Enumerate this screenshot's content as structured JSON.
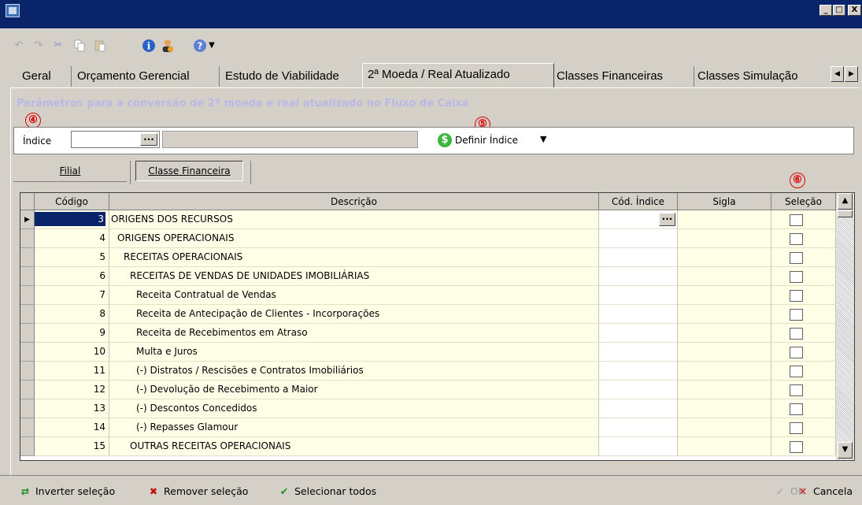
{
  "window": {
    "minimize": "_",
    "maximize": "□",
    "close": "X"
  },
  "toolbar": {
    "icons": [
      "undo-icon",
      "redo-icon",
      "cut-icon",
      "copy-icon",
      "paste-icon",
      "info-icon",
      "user-icon",
      "help-icon",
      "dropdown-arrow-icon"
    ]
  },
  "tabs": [
    {
      "label": "Geral",
      "active": false
    },
    {
      "label": "Orçamento Gerencial",
      "active": false
    },
    {
      "label": "Estudo de Viabilidade",
      "active": false
    },
    {
      "label": "2ª Moeda / Real Atualizado",
      "active": true
    },
    {
      "label": "Classes Financeiras",
      "active": false
    },
    {
      "label": "Classes Simulação",
      "active": false
    }
  ],
  "section": {
    "title": "Parâmetros para a conversão de 2ª moeda e real atualizado no Fluxo de Caixa"
  },
  "markers": {
    "m4": "④",
    "m5": "⑤",
    "m6": "⑥"
  },
  "index_field": {
    "label": "Índice",
    "value": "",
    "ellipsis": "...",
    "description": "",
    "define_label": "Definir Índice",
    "define_caret": "▼"
  },
  "subtabs": [
    {
      "label": "Filial",
      "active": false
    },
    {
      "label": "Classe Financeira",
      "active": true
    }
  ],
  "grid": {
    "columns": [
      "Código",
      "Descrição",
      "Cód. Índice",
      "Sigla",
      "Seleção"
    ],
    "rows": [
      {
        "code": "3",
        "desc": "ORIGENS DOS RECURSOS",
        "indent": 0,
        "selected": true,
        "checked": false
      },
      {
        "code": "4",
        "desc": "ORIGENS OPERACIONAIS",
        "indent": 1,
        "selected": false,
        "checked": false
      },
      {
        "code": "5",
        "desc": "RECEITAS OPERACIONAIS",
        "indent": 2,
        "selected": false,
        "checked": false
      },
      {
        "code": "6",
        "desc": "RECEITAS DE VENDAS DE UNIDADES IMOBILIÁRIAS",
        "indent": 3,
        "selected": false,
        "checked": false
      },
      {
        "code": "7",
        "desc": "Receita Contratual de Vendas",
        "indent": 4,
        "selected": false,
        "checked": false
      },
      {
        "code": "8",
        "desc": "Receita de Antecipação de Clientes - Incorporações",
        "indent": 4,
        "selected": false,
        "checked": false
      },
      {
        "code": "9",
        "desc": "Receita de Recebimentos em Atraso",
        "indent": 4,
        "selected": false,
        "checked": false
      },
      {
        "code": "10",
        "desc": "Multa e Juros",
        "indent": 4,
        "selected": false,
        "checked": false
      },
      {
        "code": "11",
        "desc": "(-) Distratos / Rescisões e Contratos Imobiliários",
        "indent": 4,
        "selected": false,
        "checked": false
      },
      {
        "code": "12",
        "desc": "(-) Devolução de Recebimento a Maior",
        "indent": 4,
        "selected": false,
        "checked": false
      },
      {
        "code": "13",
        "desc": "(-) Descontos Concedidos",
        "indent": 4,
        "selected": false,
        "checked": false
      },
      {
        "code": "14",
        "desc": "(-) Repasses Glamour",
        "indent": 4,
        "selected": false,
        "checked": false
      },
      {
        "code": "15",
        "desc": "OUTRAS RECEITAS OPERACIONAIS",
        "indent": 3,
        "selected": false,
        "checked": false
      }
    ]
  },
  "scroll": {
    "up": "▲",
    "down": "▼"
  },
  "bottom": {
    "invert": "Inverter seleção",
    "remove": "Remover seleção",
    "select_all": "Selecionar todos",
    "ok": "OK",
    "cancel": "Cancela"
  }
}
